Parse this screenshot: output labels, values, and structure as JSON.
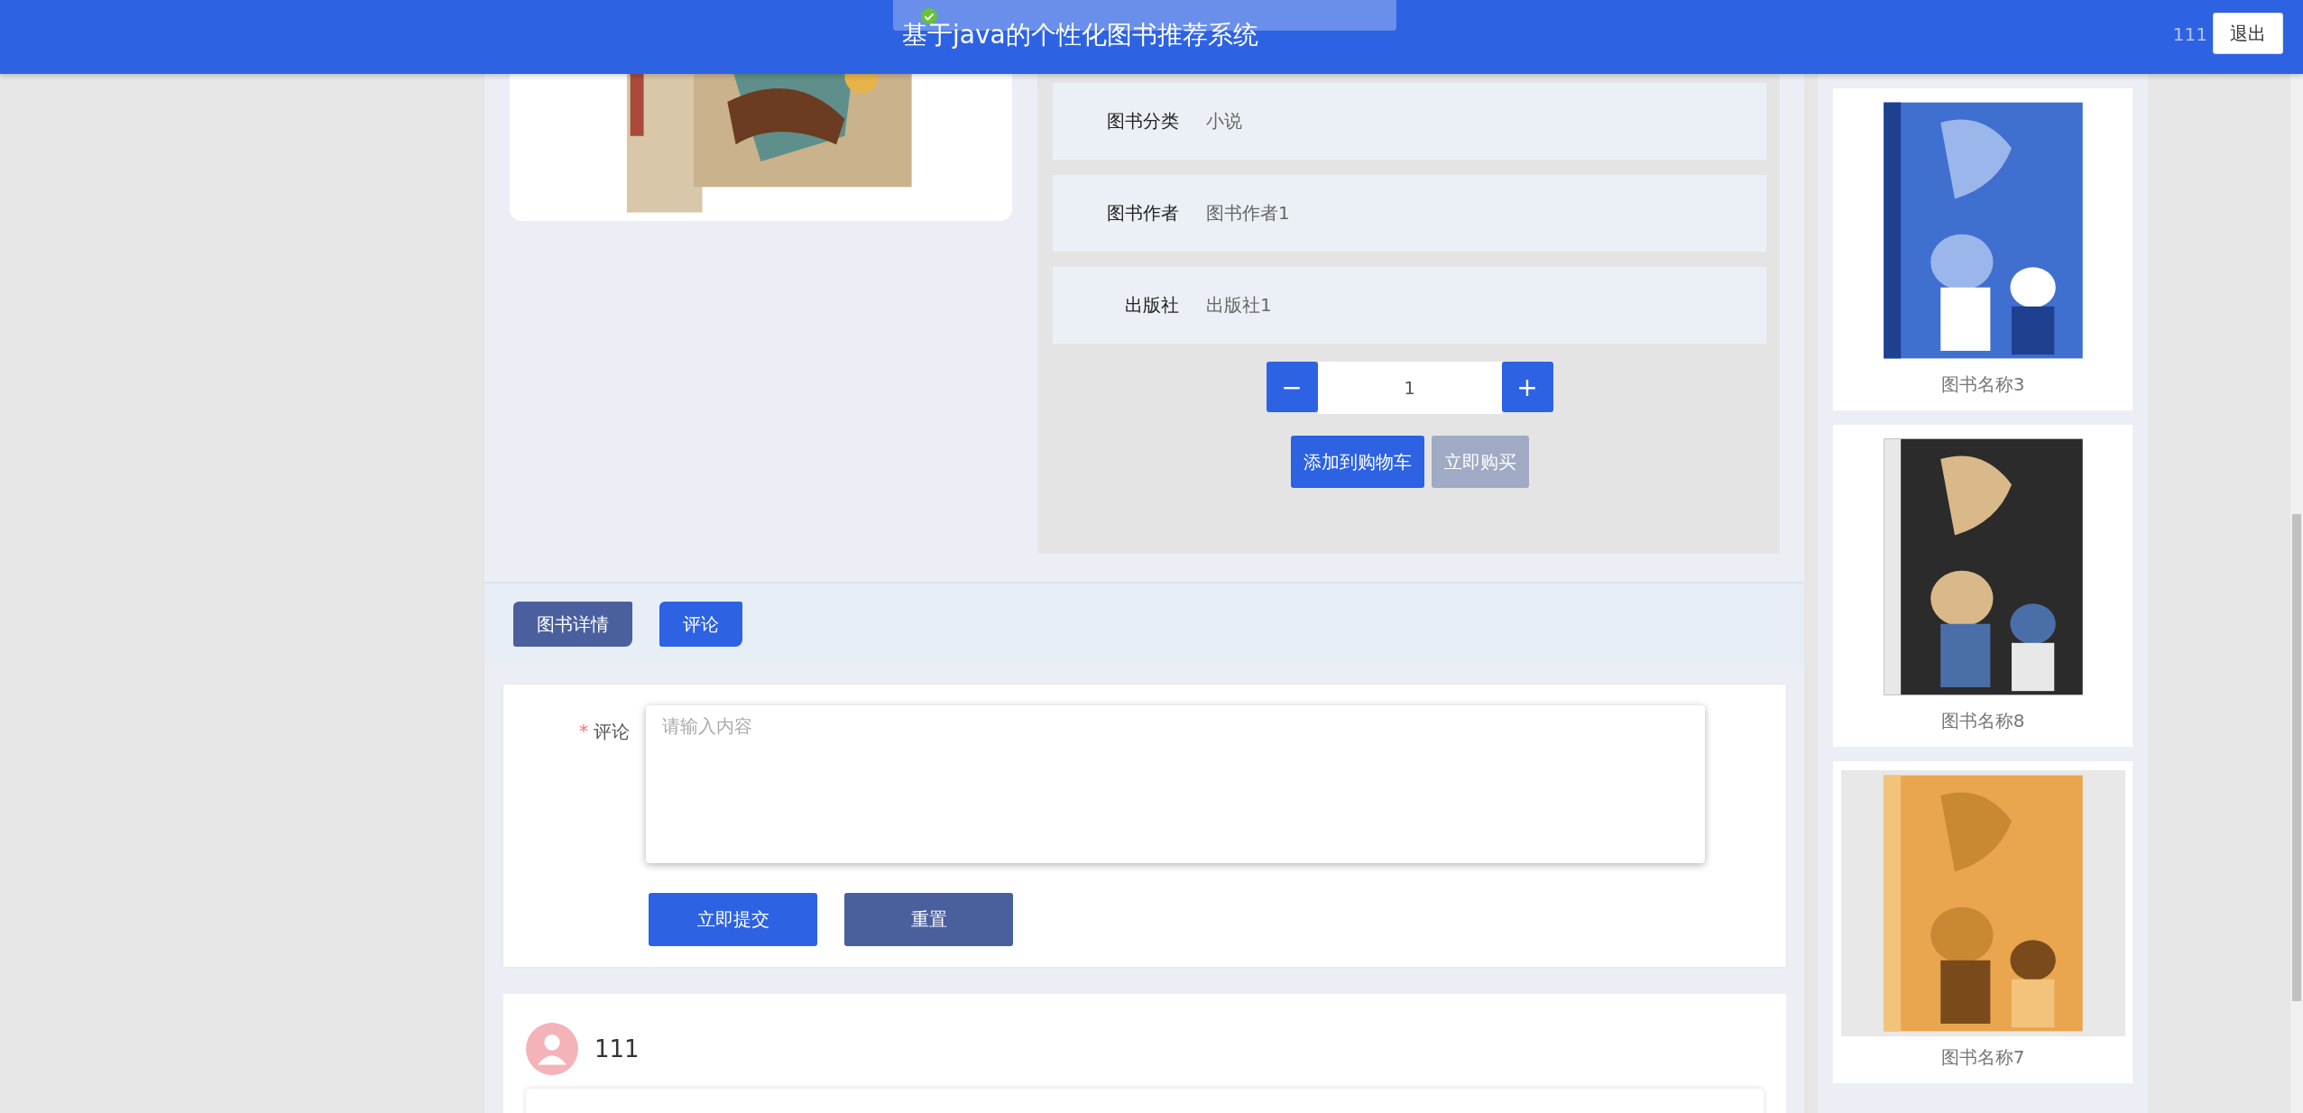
{
  "header": {
    "title": "基于java的个性化图书推荐系统",
    "user": "111",
    "logout": "退出"
  },
  "toast": {
    "kind": "success"
  },
  "details": [
    {
      "label": "图书分类",
      "value": "小说"
    },
    {
      "label": "图书作者",
      "value": "图书作者1"
    },
    {
      "label": "出版社",
      "value": "出版社1"
    }
  ],
  "quantity": {
    "minus": "−",
    "value": "1",
    "plus": "+"
  },
  "actions": [
    {
      "label": "添加到购物车",
      "disabled": false
    },
    {
      "label": "立即购买",
      "disabled": true
    }
  ],
  "tabs": [
    {
      "label": "图书详情",
      "selected": false
    },
    {
      "label": "评论",
      "selected": true
    }
  ],
  "comment_form": {
    "label": "评论",
    "required_mark": "*",
    "placeholder": "请输入内容",
    "submit": "立即提交",
    "reset": "重置"
  },
  "comments": [
    {
      "user": "111"
    }
  ],
  "recommendations": [
    {
      "name": "图书名称3"
    },
    {
      "name": "图书名称8"
    },
    {
      "name": "图书名称7"
    }
  ]
}
